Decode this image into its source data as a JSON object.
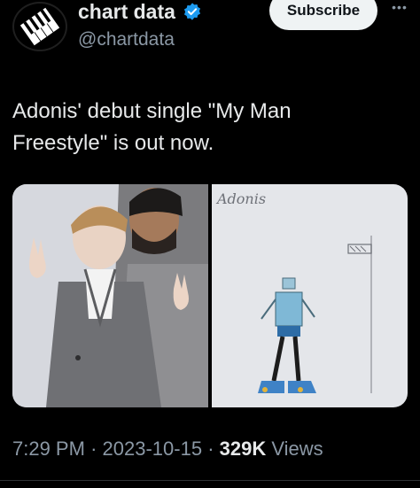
{
  "account": {
    "display_name": "chart data",
    "handle": "@chartdata",
    "avatar_icon": "piano-keys-logo-icon",
    "verified_icon": "verified-badge-icon",
    "verified_color": "#1d9bf0"
  },
  "actions": {
    "subscribe_label": "Subscribe",
    "more_label": "•••"
  },
  "tweet": {
    "text": "Adonis' debut single \"My Man\nFreestyle\" is out now."
  },
  "media": {
    "images": [
      {
        "name": "photo-adonis-and-drake",
        "description_icon": "photo"
      },
      {
        "name": "drawing-adonis",
        "drawing_caption": "Adonis"
      }
    ]
  },
  "meta": {
    "time": "7:29 PM",
    "separator": "·",
    "date": "2023-10-15",
    "views_count": "329K",
    "views_label": "Views"
  }
}
